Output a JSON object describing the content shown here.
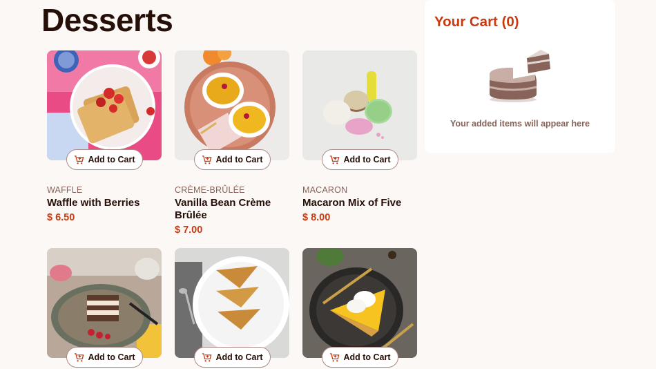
{
  "page": {
    "title": "Desserts"
  },
  "products": [
    {
      "category": "Waffle",
      "name": "Waffle with Berries",
      "price": "$ 6.50",
      "button_label": "Add to Cart"
    },
    {
      "category": "Crème-Brûlée",
      "name": "Vanilla Bean Crème Brûlée",
      "price": "$ 7.00",
      "button_label": "Add to Cart"
    },
    {
      "category": "Macaron",
      "name": "Macaron Mix of Five",
      "price": "$ 8.00",
      "button_label": "Add to Cart"
    },
    {
      "button_label": "Add to Cart"
    },
    {
      "button_label": "Add to Cart"
    },
    {
      "button_label": "Add to Cart"
    }
  ],
  "cart": {
    "title": "Your Cart (0)",
    "empty_message": "Your added items will appear here"
  },
  "colors": {
    "accent": "#c73b0f",
    "text": "#260f08",
    "muted": "#87635a",
    "background": "#fcf8f6"
  }
}
